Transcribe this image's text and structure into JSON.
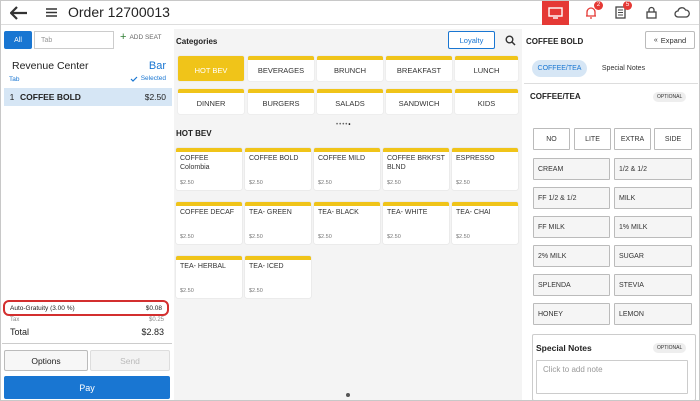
{
  "header": {
    "title": "Order 12700013",
    "badges": {
      "notifications": "2",
      "orders": "5"
    }
  },
  "left": {
    "tab_all": "All",
    "tab_placeholder": "Tab",
    "add_seat": "ADD SEAT",
    "revenue_center": "Revenue Center",
    "bar": "Bar",
    "tab_label": "Tab",
    "selected": "Selected",
    "order_items": [
      {
        "qty": "1",
        "name": "COFFEE BOLD",
        "price": "$2.50"
      }
    ],
    "auto_gratuity_label": "Auto-Gratuity (3.00 %)",
    "auto_gratuity_value": "$0.08",
    "tax_label": "Tax",
    "tax_value": "$0.25",
    "total_label": "Total",
    "total_value": "$2.83",
    "options": "Options",
    "send": "Send",
    "pay": "Pay"
  },
  "middle": {
    "categories_title": "Categories",
    "loyalty": "Loyalty",
    "categories": [
      "HOT BEV",
      "BEVERAGES",
      "BRUNCH",
      "BREAKFAST",
      "LUNCH",
      "DINNER",
      "BURGERS",
      "SALADS",
      "SANDWICH",
      "KIDS"
    ],
    "active_category": "HOT BEV",
    "section_title": "HOT BEV",
    "items": [
      {
        "name": "COFFEE Colombia",
        "price": "$2.50"
      },
      {
        "name": "COFFEE BOLD",
        "price": "$2.50"
      },
      {
        "name": "COFFEE MILD",
        "price": "$2.50"
      },
      {
        "name": "COFFEE BRKFST BLND",
        "price": "$2.50"
      },
      {
        "name": "ESPRESSO",
        "price": "$2.50"
      },
      {
        "name": "COFFEE DECAF",
        "price": "$2.50"
      },
      {
        "name": "TEA- GREEN",
        "price": "$2.50"
      },
      {
        "name": "TEA- BLACK",
        "price": "$2.50"
      },
      {
        "name": "TEA- WHITE",
        "price": "$2.50"
      },
      {
        "name": "TEA- CHAI",
        "price": "$2.50"
      },
      {
        "name": "TEA- HERBAL",
        "price": "$2.50"
      },
      {
        "name": "TEA- ICED",
        "price": "$2.50"
      }
    ]
  },
  "right": {
    "title": "COFFEE BOLD",
    "expand": "Expand",
    "tab_coffee": "COFFEE/TEA",
    "tab_notes": "Special Notes",
    "section": "COFFEE/TEA",
    "optional": "OPTIONAL",
    "amounts": [
      "NO",
      "LITE",
      "EXTRA",
      "SIDE"
    ],
    "modifiers": [
      "CREAM",
      "1/2 & 1/2",
      "FF 1/2 & 1/2",
      "MILK",
      "FF MILK",
      "1% MILK",
      "2% MILK",
      "SUGAR",
      "SPLENDA",
      "STEVIA",
      "HONEY",
      "LEMON"
    ],
    "notes_title": "Special Notes",
    "notes_optional": "OPTIONAL",
    "notes_placeholder": "Click to add note"
  },
  "colors": {
    "accent": "#1976d2",
    "category": "#f0c419",
    "alert": "#e53935"
  }
}
